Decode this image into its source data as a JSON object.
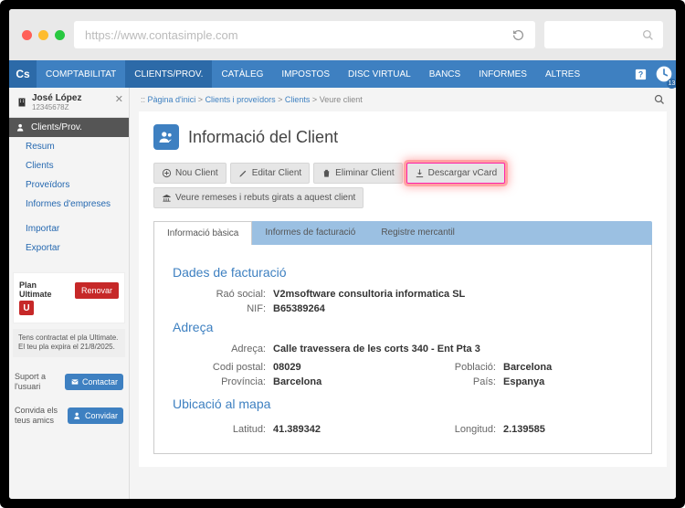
{
  "browser": {
    "url": "https://www.contasimple.com"
  },
  "nav": {
    "logo": "Cs",
    "items": [
      "COMPTABILITAT",
      "CLIENTS/PROV.",
      "CATÀLEG",
      "IMPOSTOS",
      "DISC VIRTUAL",
      "BANCS",
      "INFORMES",
      "ALTRES"
    ],
    "clock_badge": "13"
  },
  "user": {
    "name": "José López",
    "id": "12345678Z"
  },
  "sidebar": {
    "header": "Clients/Prov.",
    "links1": [
      "Resum",
      "Clients",
      "Proveïdors",
      "Informes d'empreses"
    ],
    "links2": [
      "Importar",
      "Exportar"
    ]
  },
  "plan": {
    "label": "Plan",
    "name": "Ultimate",
    "badge": "U",
    "renew": "Renovar",
    "note": "Tens contractat el pla Ultimate. El teu pla expira el 21/8/2025."
  },
  "support": {
    "label": "Suport a l'usuari",
    "button": "Contactar"
  },
  "invite": {
    "label": "Convida els teus amics",
    "button": "Convidar"
  },
  "breadcrumb": {
    "prefix": ":: ",
    "items": [
      "Pàgina d'inici",
      "Clients i proveïdors",
      "Clients"
    ],
    "current": "Veure client",
    "sep": " > "
  },
  "page": {
    "title": "Informació del Client"
  },
  "toolbar": {
    "new": "Nou Client",
    "edit": "Editar Client",
    "delete": "Eliminar Client",
    "vcard": "Descargar vCard",
    "remits": "Veure remeses i rebuts girats a aquest client"
  },
  "tabs": {
    "t0": "Informació bàsica",
    "t1": "Informes de facturació",
    "t2": "Registre mercantil"
  },
  "client": {
    "section_billing": "Dades de facturació",
    "rao_label": "Raó social:",
    "rao_value": "V2msoftware consultoria informatica SL",
    "nif_label": "NIF:",
    "nif_value": "B65389264",
    "section_address": "Adreça",
    "addr_label": "Adreça:",
    "addr_value": "Calle travessera de les corts 340 - Ent Pta 3",
    "cp_label": "Codi postal:",
    "cp_value": "08029",
    "pob_label": "Població:",
    "pob_value": "Barcelona",
    "prov_label": "Província:",
    "prov_value": "Barcelona",
    "pais_label": "País:",
    "pais_value": "Espanya",
    "section_map": "Ubicació al mapa",
    "lat_label": "Latitud:",
    "lat_value": "41.389342",
    "lon_label": "Longitud:",
    "lon_value": "2.139585"
  }
}
